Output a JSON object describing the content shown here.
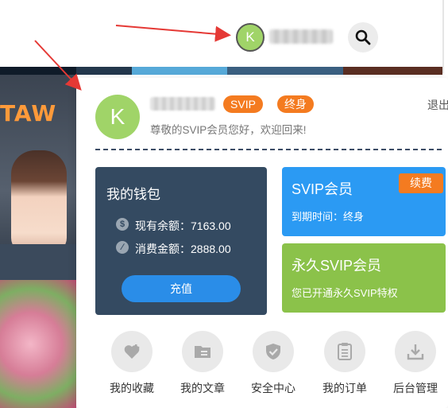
{
  "header": {
    "avatar_letter": "K",
    "search_icon": "search-icon"
  },
  "popup": {
    "avatar_letter": "K",
    "badges": {
      "svip": "SVIP",
      "lifetime": "终身"
    },
    "logout_label": "退出",
    "welcome": "尊敬的SVIP会员您好，欢迎回来!"
  },
  "wallet": {
    "title": "我的钱包",
    "balance_label": "现有余额：7163.00",
    "spent_label": "消费金额：2888.00",
    "recharge_label": "充值"
  },
  "svip_card": {
    "title": "SVIP会员",
    "renew_label": "续费",
    "expiry": "到期时间：终身"
  },
  "lifetime_card": {
    "title": "永久SVIP会员",
    "status": "您已开通永久SVIP特权"
  },
  "quick_actions": [
    {
      "label": "我的收藏",
      "icon": "heart-plus-icon"
    },
    {
      "label": "我的文章",
      "icon": "folder-icon"
    },
    {
      "label": "安全中心",
      "icon": "shield-icon"
    },
    {
      "label": "我的订单",
      "icon": "clipboard-icon"
    },
    {
      "label": "后台管理",
      "icon": "download-icon"
    }
  ],
  "background": {
    "banner_text": "TAW"
  },
  "colors": {
    "accent_orange": "#f47b20",
    "svip_blue": "#2b9af3",
    "lifetime_green": "#8bc24a",
    "wallet_navy": "#344a61",
    "recharge_blue": "#2a8de8",
    "avatar_green": "#a0d468",
    "arrow_red": "#e53935"
  }
}
